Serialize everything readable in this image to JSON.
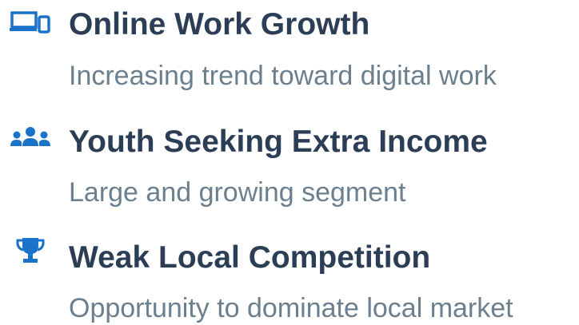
{
  "items": [
    {
      "icon": "devices-icon",
      "title": "Online Work Growth",
      "subtitle": "Increasing trend toward digital work"
    },
    {
      "icon": "users-icon",
      "title": "Youth Seeking Extra Income",
      "subtitle": "Large and growing segment"
    },
    {
      "icon": "trophy-icon",
      "title": "Weak Local Competition",
      "subtitle": "Opportunity to dominate local market"
    }
  ],
  "colors": {
    "icon": "#1a73c8",
    "title": "#2c3e55",
    "subtitle": "#6b7f8e"
  }
}
